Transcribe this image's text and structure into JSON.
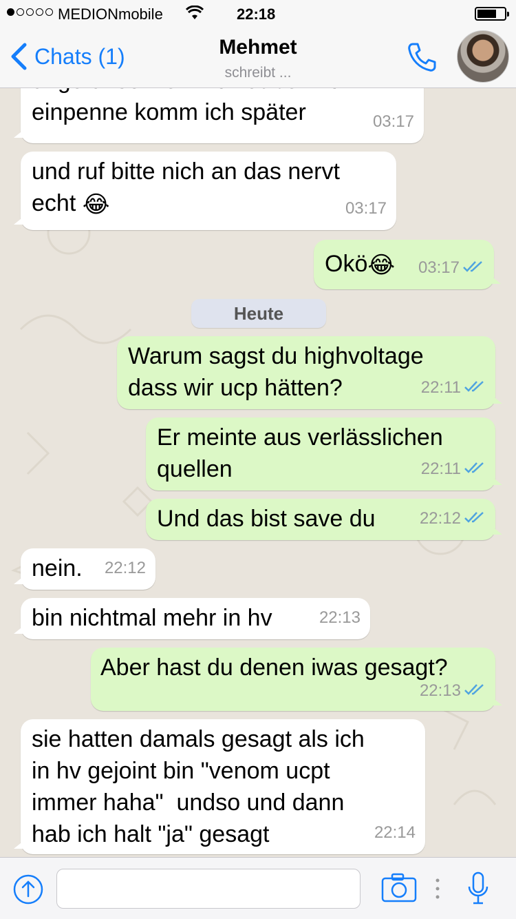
{
  "status_bar": {
    "carrier": "MEDIONmobile",
    "time": "22:18",
    "signal_bars": 1,
    "signal_total": 5,
    "battery_level": 0.7,
    "wifi_icon": "wifi-icon"
  },
  "nav": {
    "back_label": "Chats (1)",
    "contact_name": "Mehmet",
    "status": "schreibt ...",
    "call_icon": "phone-icon",
    "accent": "#157efb"
  },
  "chat": {
    "date_separator": "Heute",
    "messages": [
      {
        "dir": "in",
        "text": "unge unso wenn ich dabei nich\neinpenne komm ich später",
        "time": "03:17"
      },
      {
        "dir": "in",
        "text": "und ruf bitte nich an das nervt\necht",
        "emoji": "😂",
        "time": "03:17"
      },
      {
        "dir": "out",
        "text": "Okö",
        "emoji": "😂",
        "time": "03:17",
        "read": true
      },
      {
        "dir": "out",
        "text": "Warum sagst du highvoltage\ndass wir ucp hätten?",
        "time": "22:11",
        "read": true
      },
      {
        "dir": "out",
        "text": "Er meinte aus verlässlichen\nquellen",
        "time": "22:11",
        "read": true
      },
      {
        "dir": "out",
        "text": "Und das bist save du",
        "time": "22:12",
        "read": true
      },
      {
        "dir": "in",
        "text": "nein.",
        "time": "22:12"
      },
      {
        "dir": "in",
        "text": "bin nichtmal mehr in hv",
        "time": "22:13"
      },
      {
        "dir": "out",
        "text": "Aber hast du denen iwas gesagt?",
        "time": "22:13",
        "read": true
      },
      {
        "dir": "in",
        "text": "sie hatten damals gesagt als ich\nin hv gejoint bin \"venom ucpt\nimmer haha\"  undso und dann\nhab ich halt \"ja\" gesagt",
        "time": "22:14"
      }
    ],
    "colors": {
      "incoming": "#ffffff",
      "outgoing": "#dcf8c6",
      "read_ticks": "#4fa3e0"
    }
  },
  "input_bar": {
    "message_value": "",
    "icons": [
      "upload-icon",
      "camera-icon",
      "more-icon",
      "microphone-icon"
    ]
  }
}
